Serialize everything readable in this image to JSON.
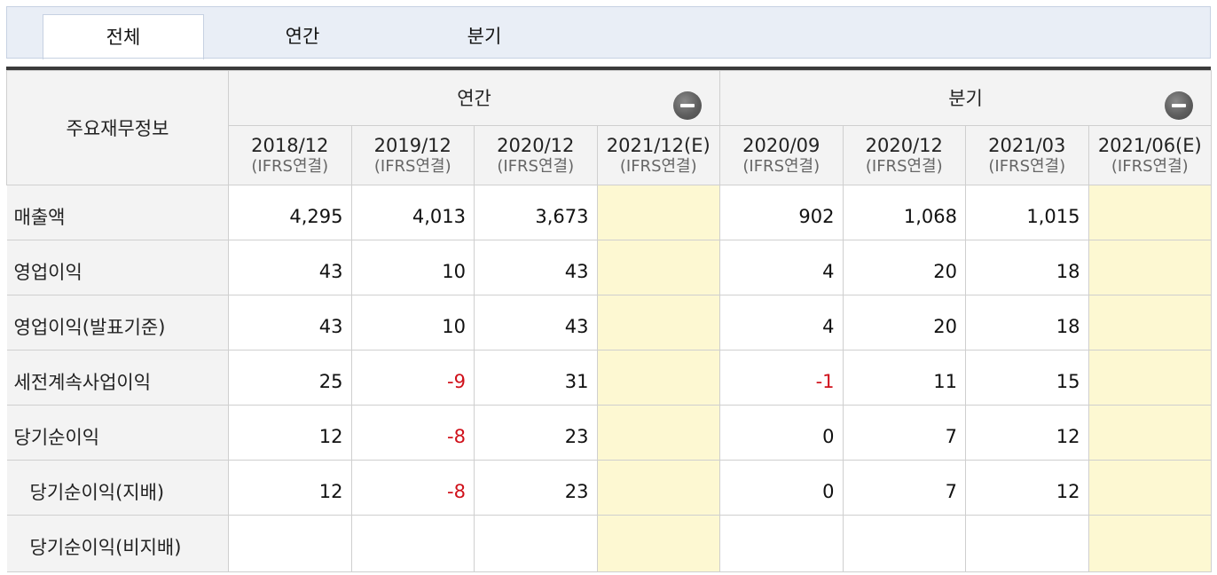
{
  "tabs": [
    {
      "label": "전체",
      "active": true
    },
    {
      "label": "연간",
      "active": false
    },
    {
      "label": "분기",
      "active": false
    }
  ],
  "table": {
    "corner_label": "주요재무정보",
    "groups": [
      {
        "label": "연간",
        "collapse_icon": "minus-circle-icon"
      },
      {
        "label": "분기",
        "collapse_icon": "minus-circle-icon"
      }
    ],
    "periods": [
      {
        "date": "2018/12",
        "basis": "(IFRS연결)"
      },
      {
        "date": "2019/12",
        "basis": "(IFRS연결)"
      },
      {
        "date": "2020/12",
        "basis": "(IFRS연결)"
      },
      {
        "date": "2021/12(E)",
        "basis": "(IFRS연결)"
      },
      {
        "date": "2020/09",
        "basis": "(IFRS연결)"
      },
      {
        "date": "2020/12",
        "basis": "(IFRS연결)"
      },
      {
        "date": "2021/03",
        "basis": "(IFRS연결)"
      },
      {
        "date": "2021/06(E)",
        "basis": "(IFRS연결)"
      }
    ],
    "rows": [
      {
        "label": "매출액",
        "values": [
          "4,295",
          "4,013",
          "3,673",
          "",
          "902",
          "1,068",
          "1,015",
          ""
        ]
      },
      {
        "label": "영업이익",
        "values": [
          "43",
          "10",
          "43",
          "",
          "4",
          "20",
          "18",
          ""
        ]
      },
      {
        "label": "영업이익(발표기준)",
        "values": [
          "43",
          "10",
          "43",
          "",
          "4",
          "20",
          "18",
          ""
        ]
      },
      {
        "label": "세전계속사업이익",
        "values": [
          "25",
          "-9",
          "31",
          "",
          "-1",
          "11",
          "15",
          ""
        ]
      },
      {
        "label": "당기순이익",
        "values": [
          "12",
          "-8",
          "23",
          "",
          "0",
          "7",
          "12",
          ""
        ]
      },
      {
        "label": "당기순이익(지배)",
        "values": [
          "12",
          "-8",
          "23",
          "",
          "0",
          "7",
          "12",
          ""
        ]
      },
      {
        "label": "당기순이익(비지배)",
        "values": [
          "",
          "",
          "",
          "",
          "",
          "",
          "",
          ""
        ]
      }
    ]
  },
  "colors": {
    "negative": "#d0111b",
    "estimate_bg": "#fdf8d2",
    "header_bg": "#f3f3f3",
    "tab_strip_bg": "#e9eef6"
  }
}
